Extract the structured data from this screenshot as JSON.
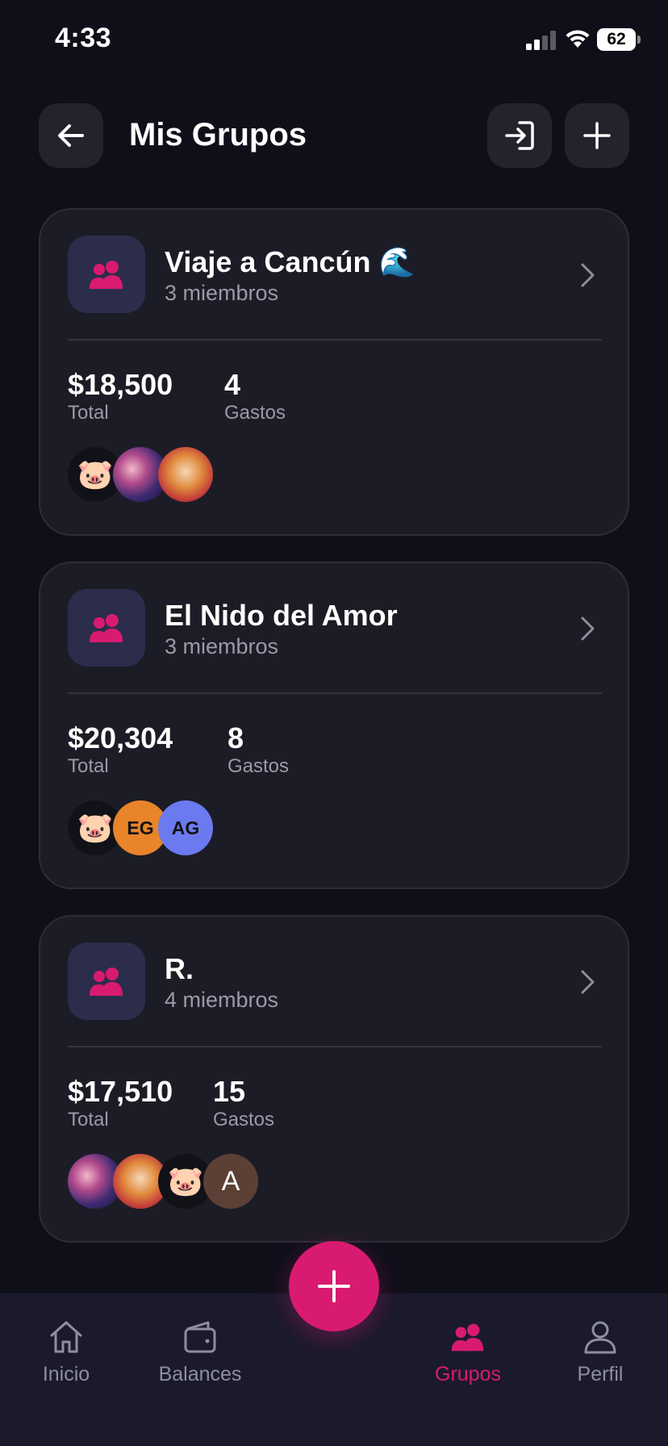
{
  "status_bar": {
    "time": "4:33",
    "battery": "62"
  },
  "header": {
    "title": "Mis Grupos",
    "back_icon": "arrow-left-icon",
    "join_icon": "login-icon",
    "add_icon": "plus-icon"
  },
  "groups": [
    {
      "name": "Viaje a Cancún 🌊",
      "members": "3 miembros",
      "total": "$18,500",
      "total_label": "Total",
      "expenses": "4",
      "expenses_label": "Gastos",
      "avatars": [
        {
          "type": "pig",
          "text": "🐷"
        },
        {
          "type": "art",
          "text": ""
        },
        {
          "type": "girl",
          "text": ""
        }
      ]
    },
    {
      "name": "El Nido del Amor",
      "members": "3 miembros",
      "total": "$20,304",
      "total_label": "Total",
      "expenses": "8",
      "expenses_label": "Gastos",
      "avatars": [
        {
          "type": "pig",
          "text": "🐷"
        },
        {
          "type": "eg",
          "text": "EG"
        },
        {
          "type": "ag",
          "text": "AG"
        }
      ]
    },
    {
      "name": "R.",
      "members": "4 miembros",
      "total": "$17,510",
      "total_label": "Total",
      "expenses": "15",
      "expenses_label": "Gastos",
      "avatars": [
        {
          "type": "art",
          "text": ""
        },
        {
          "type": "girl",
          "text": ""
        },
        {
          "type": "pig",
          "text": "🐷"
        },
        {
          "type": "a",
          "text": "A"
        }
      ]
    }
  ],
  "bottom_nav": {
    "items": [
      {
        "label": "Inicio",
        "icon": "home-icon"
      },
      {
        "label": "Balances",
        "icon": "wallet-icon"
      },
      {
        "label": "Grupos",
        "icon": "users-icon",
        "active": true
      },
      {
        "label": "Perfil",
        "icon": "user-icon"
      }
    ],
    "fab_icon": "plus-icon"
  },
  "colors": {
    "background": "#0f0f1a",
    "card": "#1c1c26",
    "accent": "#d81b70",
    "muted_text": "#9a9aa8",
    "nav_background": "#1a1a2c"
  }
}
